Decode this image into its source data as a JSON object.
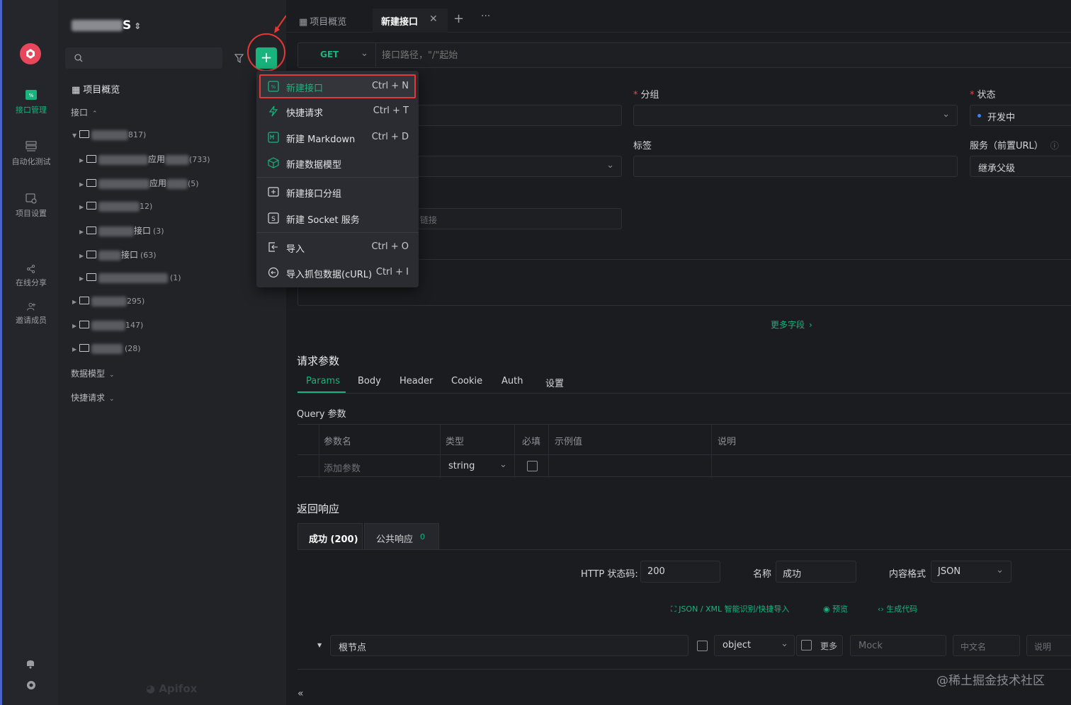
{
  "rail": {
    "items": [
      {
        "label": "接口管理"
      },
      {
        "label": "自动化测试"
      },
      {
        "label": "项目设置"
      },
      {
        "label": "在线分享"
      },
      {
        "label": "邀请成员"
      }
    ]
  },
  "sidebar": {
    "project_suffix": "S",
    "overview_label": "项目概览",
    "api_section": "接口",
    "tree": [
      {
        "partial": "817)"
      },
      {
        "partial": "应用",
        "count": "(733)"
      },
      {
        "partial": "应用",
        "count": "(5)"
      },
      {
        "partial": "12)"
      },
      {
        "partial": "接口",
        "count": "(3)"
      },
      {
        "partial": "接口",
        "count": "(63)"
      },
      {
        "partial": "",
        "count": "(1)"
      },
      {
        "partial": "295)"
      },
      {
        "partial": "147)"
      },
      {
        "partial": "",
        "count": "(28)"
      }
    ],
    "data_models": "数据模型",
    "quick_requests": "快捷请求",
    "brand": "Apifox"
  },
  "tabs": {
    "overview": "项目概览",
    "new_api": "新建接口"
  },
  "request": {
    "method": "GET",
    "path_placeholder": "接口路径，\"/\"起始"
  },
  "form": {
    "group_label": "分组",
    "status_label": "状态",
    "status_value": "开发中",
    "tags_label": "标签",
    "service_label": "服务（前置URL）",
    "service_value": "继承父级",
    "link_placeholder": "链接",
    "more_fields": "更多字段"
  },
  "menu": {
    "items": [
      {
        "label": "新建接口",
        "shortcut": "Ctrl + N"
      },
      {
        "label": "快捷请求",
        "shortcut": "Ctrl + T"
      },
      {
        "label": "新建 Markdown",
        "shortcut": "Ctrl + D"
      },
      {
        "label": "新建数据模型",
        "shortcut": ""
      },
      {
        "label": "新建接口分组",
        "shortcut": ""
      },
      {
        "label": "新建 Socket 服务",
        "shortcut": ""
      },
      {
        "label": "导入",
        "shortcut": "Ctrl + O"
      },
      {
        "label": "导入抓包数据(cURL)",
        "shortcut": "Ctrl + I"
      }
    ]
  },
  "params": {
    "title": "请求参数",
    "tabs": [
      "Params",
      "Body",
      "Header",
      "Cookie",
      "Auth",
      "设置"
    ],
    "query_title": "Query 参数",
    "columns": [
      "参数名",
      "类型",
      "必填",
      "示例值",
      "说明"
    ],
    "add_placeholder": "添加参数",
    "type_value": "string"
  },
  "response": {
    "title": "返回响应",
    "tab_success": "成功 (200)",
    "tab_public": "公共响应",
    "tab_public_count": "0",
    "http_label": "HTTP 状态码:",
    "http_value": "200",
    "name_label": "名称",
    "name_value": "成功",
    "content_label": "内容格式",
    "content_value": "JSON",
    "link_import": "JSON / XML 智能识别/快捷导入",
    "link_preview": "预览",
    "link_code": "生成代码",
    "root_label": "根节点",
    "root_type": "object",
    "more": "更多",
    "mock_placeholder": "Mock",
    "cn_placeholder": "中文名",
    "desc_placeholder": "说明"
  },
  "watermark": "@稀土掘金技术社区",
  "colors": {
    "accent": "#19b37d",
    "highlight": "#e53935",
    "rail_border": "#4a63c8"
  }
}
